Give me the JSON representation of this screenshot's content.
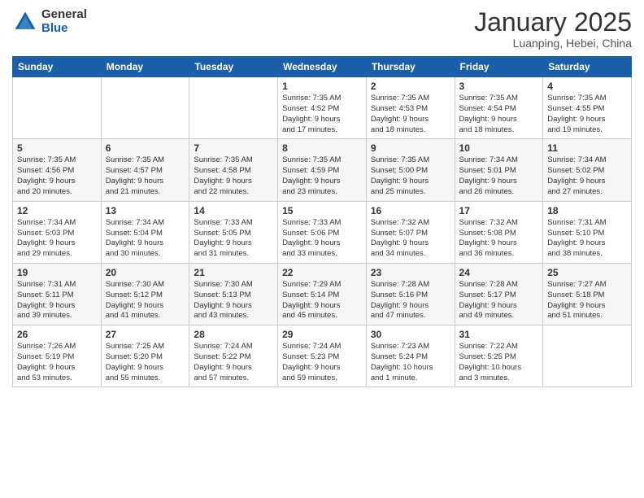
{
  "logo": {
    "general": "General",
    "blue": "Blue"
  },
  "header": {
    "title": "January 2025",
    "subtitle": "Luanping, Hebei, China"
  },
  "days_of_week": [
    "Sunday",
    "Monday",
    "Tuesday",
    "Wednesday",
    "Thursday",
    "Friday",
    "Saturday"
  ],
  "weeks": [
    [
      {
        "day": "",
        "info": ""
      },
      {
        "day": "",
        "info": ""
      },
      {
        "day": "",
        "info": ""
      },
      {
        "day": "1",
        "info": "Sunrise: 7:35 AM\nSunset: 4:52 PM\nDaylight: 9 hours\nand 17 minutes."
      },
      {
        "day": "2",
        "info": "Sunrise: 7:35 AM\nSunset: 4:53 PM\nDaylight: 9 hours\nand 18 minutes."
      },
      {
        "day": "3",
        "info": "Sunrise: 7:35 AM\nSunset: 4:54 PM\nDaylight: 9 hours\nand 18 minutes."
      },
      {
        "day": "4",
        "info": "Sunrise: 7:35 AM\nSunset: 4:55 PM\nDaylight: 9 hours\nand 19 minutes."
      }
    ],
    [
      {
        "day": "5",
        "info": "Sunrise: 7:35 AM\nSunset: 4:56 PM\nDaylight: 9 hours\nand 20 minutes."
      },
      {
        "day": "6",
        "info": "Sunrise: 7:35 AM\nSunset: 4:57 PM\nDaylight: 9 hours\nand 21 minutes."
      },
      {
        "day": "7",
        "info": "Sunrise: 7:35 AM\nSunset: 4:58 PM\nDaylight: 9 hours\nand 22 minutes."
      },
      {
        "day": "8",
        "info": "Sunrise: 7:35 AM\nSunset: 4:59 PM\nDaylight: 9 hours\nand 23 minutes."
      },
      {
        "day": "9",
        "info": "Sunrise: 7:35 AM\nSunset: 5:00 PM\nDaylight: 9 hours\nand 25 minutes."
      },
      {
        "day": "10",
        "info": "Sunrise: 7:34 AM\nSunset: 5:01 PM\nDaylight: 9 hours\nand 26 minutes."
      },
      {
        "day": "11",
        "info": "Sunrise: 7:34 AM\nSunset: 5:02 PM\nDaylight: 9 hours\nand 27 minutes."
      }
    ],
    [
      {
        "day": "12",
        "info": "Sunrise: 7:34 AM\nSunset: 5:03 PM\nDaylight: 9 hours\nand 29 minutes."
      },
      {
        "day": "13",
        "info": "Sunrise: 7:34 AM\nSunset: 5:04 PM\nDaylight: 9 hours\nand 30 minutes."
      },
      {
        "day": "14",
        "info": "Sunrise: 7:33 AM\nSunset: 5:05 PM\nDaylight: 9 hours\nand 31 minutes."
      },
      {
        "day": "15",
        "info": "Sunrise: 7:33 AM\nSunset: 5:06 PM\nDaylight: 9 hours\nand 33 minutes."
      },
      {
        "day": "16",
        "info": "Sunrise: 7:32 AM\nSunset: 5:07 PM\nDaylight: 9 hours\nand 34 minutes."
      },
      {
        "day": "17",
        "info": "Sunrise: 7:32 AM\nSunset: 5:08 PM\nDaylight: 9 hours\nand 36 minutes."
      },
      {
        "day": "18",
        "info": "Sunrise: 7:31 AM\nSunset: 5:10 PM\nDaylight: 9 hours\nand 38 minutes."
      }
    ],
    [
      {
        "day": "19",
        "info": "Sunrise: 7:31 AM\nSunset: 5:11 PM\nDaylight: 9 hours\nand 39 minutes."
      },
      {
        "day": "20",
        "info": "Sunrise: 7:30 AM\nSunset: 5:12 PM\nDaylight: 9 hours\nand 41 minutes."
      },
      {
        "day": "21",
        "info": "Sunrise: 7:30 AM\nSunset: 5:13 PM\nDaylight: 9 hours\nand 43 minutes."
      },
      {
        "day": "22",
        "info": "Sunrise: 7:29 AM\nSunset: 5:14 PM\nDaylight: 9 hours\nand 45 minutes."
      },
      {
        "day": "23",
        "info": "Sunrise: 7:28 AM\nSunset: 5:16 PM\nDaylight: 9 hours\nand 47 minutes."
      },
      {
        "day": "24",
        "info": "Sunrise: 7:28 AM\nSunset: 5:17 PM\nDaylight: 9 hours\nand 49 minutes."
      },
      {
        "day": "25",
        "info": "Sunrise: 7:27 AM\nSunset: 5:18 PM\nDaylight: 9 hours\nand 51 minutes."
      }
    ],
    [
      {
        "day": "26",
        "info": "Sunrise: 7:26 AM\nSunset: 5:19 PM\nDaylight: 9 hours\nand 53 minutes."
      },
      {
        "day": "27",
        "info": "Sunrise: 7:25 AM\nSunset: 5:20 PM\nDaylight: 9 hours\nand 55 minutes."
      },
      {
        "day": "28",
        "info": "Sunrise: 7:24 AM\nSunset: 5:22 PM\nDaylight: 9 hours\nand 57 minutes."
      },
      {
        "day": "29",
        "info": "Sunrise: 7:24 AM\nSunset: 5:23 PM\nDaylight: 9 hours\nand 59 minutes."
      },
      {
        "day": "30",
        "info": "Sunrise: 7:23 AM\nSunset: 5:24 PM\nDaylight: 10 hours\nand 1 minute."
      },
      {
        "day": "31",
        "info": "Sunrise: 7:22 AM\nSunset: 5:25 PM\nDaylight: 10 hours\nand 3 minutes."
      },
      {
        "day": "",
        "info": ""
      }
    ]
  ]
}
